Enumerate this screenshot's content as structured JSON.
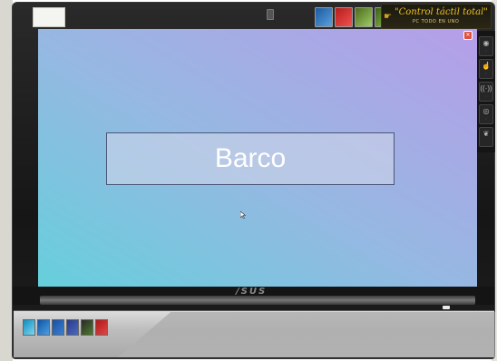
{
  "screen": {
    "word": "Barco"
  },
  "promo": {
    "title": "\"Control táctil total\"",
    "subtitle": "PC TODO EN UNO"
  },
  "bezel": {
    "brand": "/SUS"
  },
  "side_panel": {
    "buttons": [
      "disc-icon",
      "touch-icon",
      "wifi-icon",
      "eye-icon",
      "leaf-icon"
    ]
  },
  "stickers": {
    "top": [
      "windows-badge",
      "ati-badge",
      "green-badge",
      "nvidia-badge"
    ],
    "bottom": [
      "intel-badge",
      "intel-core-badge",
      "windows7-badge",
      "windows-badge",
      "nvidia-badge",
      "ati-badge"
    ]
  },
  "colors": {
    "screen_top": "#b69ee8",
    "screen_bottom": "#66cfdc",
    "word_text": "#ffffff"
  }
}
